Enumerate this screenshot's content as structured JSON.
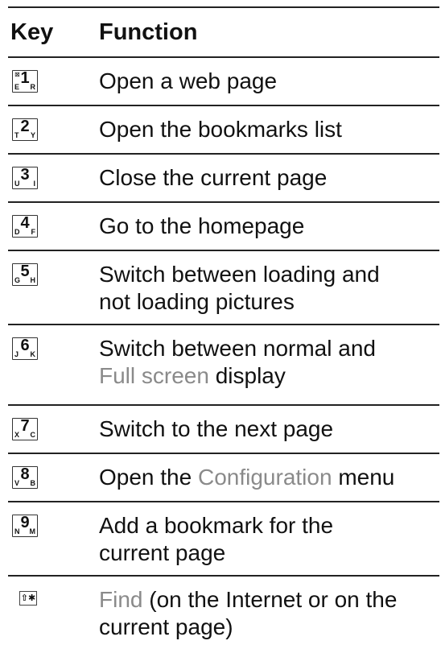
{
  "table": {
    "header": {
      "key": "Key",
      "function": "Function"
    },
    "rows": [
      {
        "key": {
          "digit": "1",
          "left": "E",
          "right": "R",
          "sub": "⊠"
        },
        "line1": "Open a web page"
      },
      {
        "key": {
          "digit": "2",
          "left": "T",
          "right": "Y"
        },
        "line1": "Open the bookmarks list"
      },
      {
        "key": {
          "digit": "3",
          "left": "U",
          "right": "I"
        },
        "line1": "Close the current page"
      },
      {
        "key": {
          "digit": "4",
          "left": "D",
          "right": "F"
        },
        "line1": "Go to the homepage"
      },
      {
        "key": {
          "digit": "5",
          "left": "G",
          "right": "H"
        },
        "line1": "Switch between loading and",
        "line2": "not loading pictures"
      },
      {
        "key": {
          "digit": "6",
          "left": "J",
          "right": "K"
        },
        "line1": "Switch between normal and",
        "line2_highlight": "Full screen",
        "line2_rest": " display"
      },
      {
        "key": {
          "digit": "7",
          "left": "X",
          "right": "C"
        },
        "line1": "Switch to the next page"
      },
      {
        "key": {
          "digit": "8",
          "left": "V",
          "right": "B"
        },
        "line1_pre": "Open the ",
        "line1_highlight": "Configuration",
        "line1_post": " menu"
      },
      {
        "key": {
          "digit": "9",
          "left": "N",
          "right": "M"
        },
        "line1": "Add a bookmark for the",
        "line2": "current page"
      },
      {
        "key": {
          "glyph": "⇧✱"
        },
        "line1_highlight": "Find",
        "line1_post": " (on the Internet or on the",
        "line2": "current page)"
      }
    ]
  }
}
